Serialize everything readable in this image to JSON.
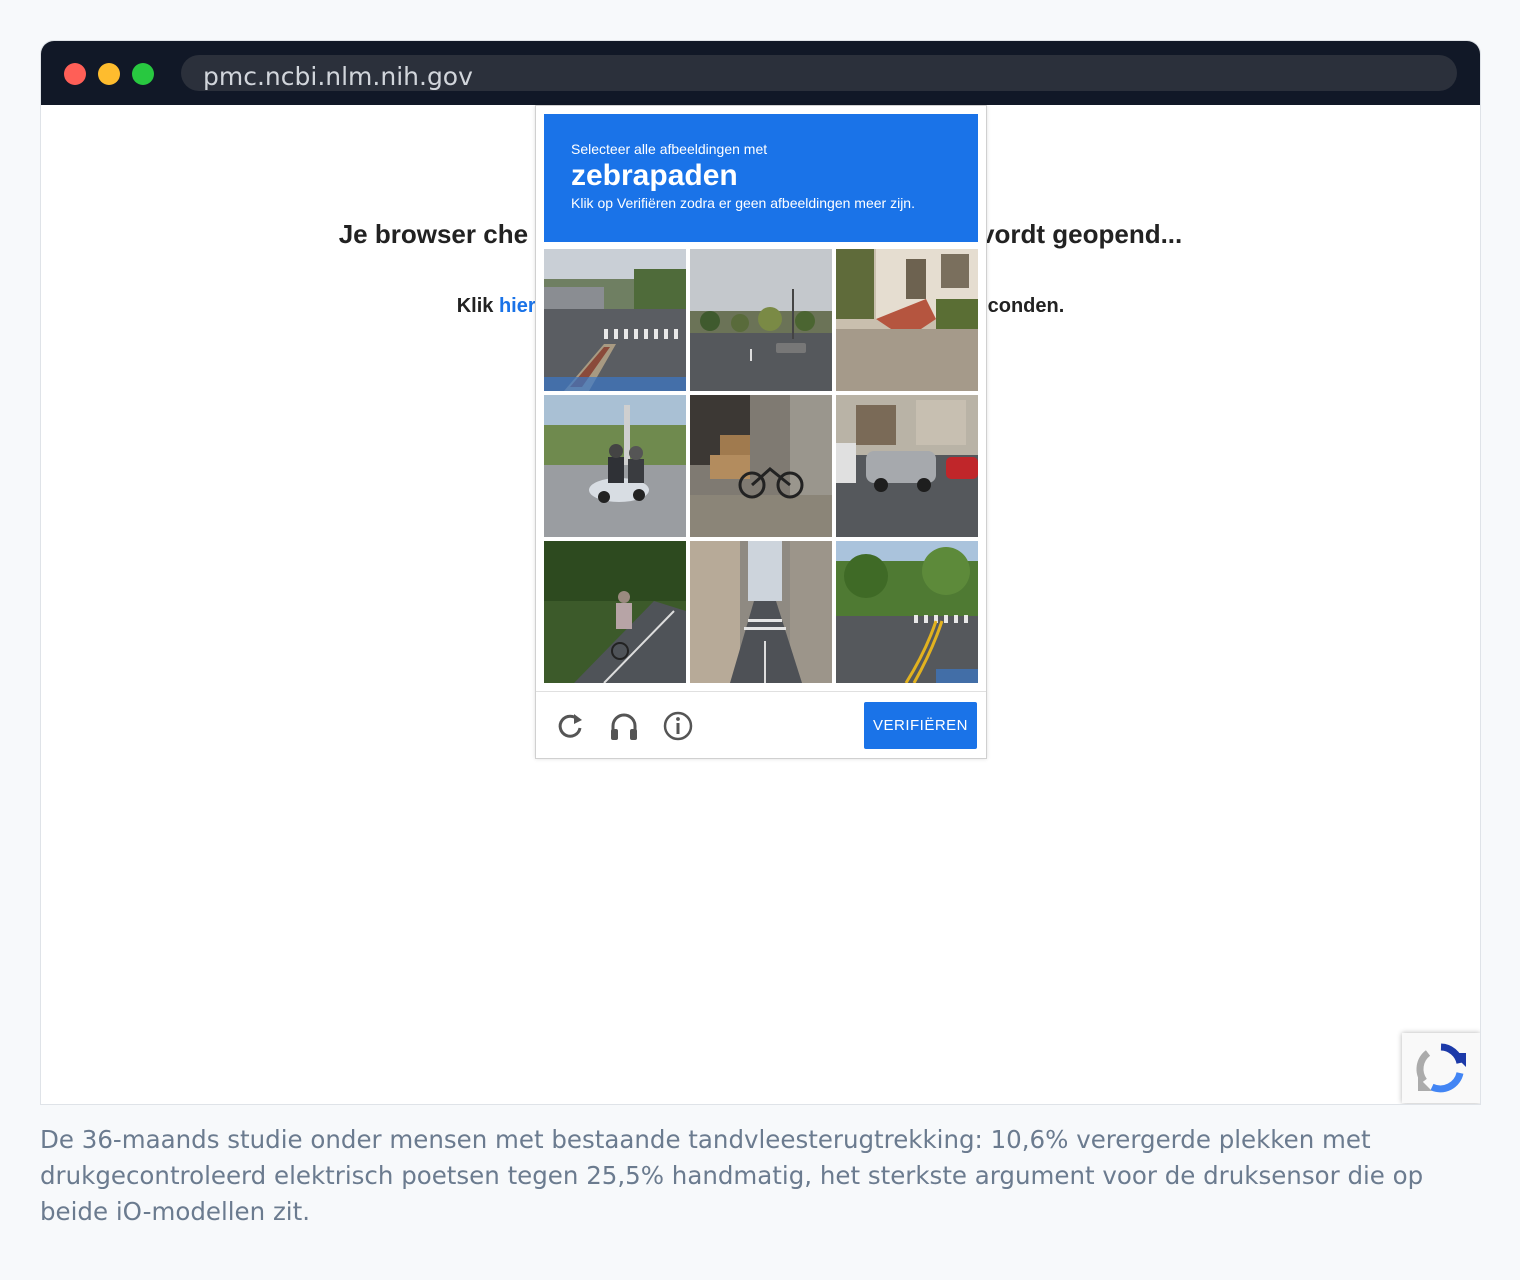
{
  "browser": {
    "url": "pmc.ncbi.nlm.nih.gov"
  },
  "page": {
    "heading": "Je browser checkt of het veilig is, de pagina wordt geopend...",
    "heading_left": "Je browser che",
    "heading_right": "vordt geopend...",
    "subline_left": "Klik ",
    "subline_link": "hier",
    "subline_right": "conden."
  },
  "captcha": {
    "instruction": "Selecteer alle afbeeldingen met",
    "keyword": "zebrapaden",
    "hint": "Klik op Verifiëren zodra er geen afbeeldingen meer zijn.",
    "tiles": [
      {
        "name": "street-crosswalk-median"
      },
      {
        "name": "road-intersection"
      },
      {
        "name": "house-steps"
      },
      {
        "name": "scooter-riders"
      },
      {
        "name": "bicycle-boxes"
      },
      {
        "name": "cars-street"
      },
      {
        "name": "cyclist-path"
      },
      {
        "name": "narrow-street-crosswalk"
      },
      {
        "name": "road-crosswalk-trees"
      }
    ],
    "icons": {
      "reload": "reload-icon",
      "audio": "headphones-icon",
      "info": "info-icon"
    },
    "verify_label": "VERIFIËREN",
    "accent": "#1a73e8"
  },
  "caption": {
    "text": "De 36-maands studie onder mensen met bestaande tandvleesterugtrekking: 10,6% verergerde plekken met drukgecontroleerd elektrisch poetsen tegen 25,5% handmatig, het sterkste argument voor de druksensor die op beide iO-modellen zit."
  }
}
